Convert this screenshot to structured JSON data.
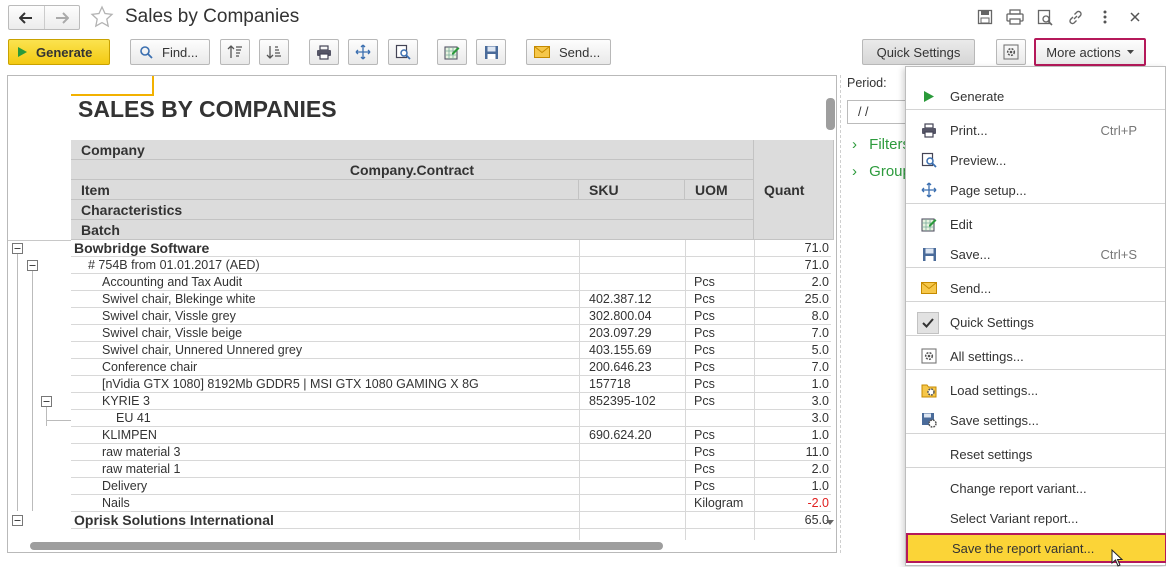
{
  "window": {
    "title": "Sales by Companies"
  },
  "toolbar": {
    "generate_label": "Generate",
    "find_label": "Find...",
    "send_label": "Send...",
    "quick_settings_label": "Quick Settings",
    "more_actions_label": "More actions"
  },
  "report": {
    "title": "SALES BY COMPANIES",
    "headers": {
      "company": "Company",
      "contract": "Company.Contract",
      "item": "Item",
      "sku": "SKU",
      "uom": "UOM",
      "characteristics": "Characteristics",
      "batch": "Batch",
      "quantity": "Quant"
    },
    "rows": [
      {
        "name": "Bowbridge Software",
        "sku": "",
        "uom": "",
        "qty": "71.0",
        "level": 0
      },
      {
        "name": "# 754B from 01.01.2017 (AED)",
        "sku": "",
        "uom": "",
        "qty": "71.0",
        "level": 1
      },
      {
        "name": "Accounting and Tax Audit",
        "sku": "",
        "uom": "Pcs",
        "qty": "2.0",
        "level": 2
      },
      {
        "name": "Swivel chair, Blekinge white",
        "sku": "402.387.12",
        "uom": "Pcs",
        "qty": "25.0",
        "level": 2
      },
      {
        "name": "Swivel chair, Vissle grey",
        "sku": "302.800.04",
        "uom": "Pcs",
        "qty": "8.0",
        "level": 2
      },
      {
        "name": "Swivel chair, Vissle beige",
        "sku": "203.097.29",
        "uom": "Pcs",
        "qty": "7.0",
        "level": 2
      },
      {
        "name": "Swivel chair, Unnered Unnered grey",
        "sku": "403.155.69",
        "uom": "Pcs",
        "qty": "5.0",
        "level": 2
      },
      {
        "name": "Conference chair",
        "sku": "200.646.23",
        "uom": "Pcs",
        "qty": "7.0",
        "level": 2
      },
      {
        "name": "[nVidia GTX 1080] 8192Mb GDDR5 | MSI GTX 1080 GAMING X 8G",
        "sku": "157718",
        "uom": "Pcs",
        "qty": "1.0",
        "level": 2
      },
      {
        "name": "KYRIE 3",
        "sku": "852395-102",
        "uom": "Pcs",
        "qty": "3.0",
        "level": 2
      },
      {
        "name": "EU 41",
        "sku": "",
        "uom": "",
        "qty": "3.0",
        "level": 3
      },
      {
        "name": "KLIMPEN",
        "sku": "690.624.20",
        "uom": "Pcs",
        "qty": "1.0",
        "level": 2
      },
      {
        "name": "raw material 3",
        "sku": "",
        "uom": "Pcs",
        "qty": "11.0",
        "level": 2
      },
      {
        "name": "raw material 1",
        "sku": "",
        "uom": "Pcs",
        "qty": "2.0",
        "level": 2
      },
      {
        "name": "Delivery",
        "sku": "",
        "uom": "Pcs",
        "qty": "1.0",
        "level": 2
      },
      {
        "name": "Nails",
        "sku": "",
        "uom": "Kilogram",
        "qty": "-2.0",
        "level": 2,
        "negative": true
      },
      {
        "name": "Oprisk Solutions International",
        "sku": "",
        "uom": "",
        "qty": "65.0",
        "level": 0
      }
    ]
  },
  "panel": {
    "period_label": "Period:",
    "period_value": "/ /",
    "filters_label": "Filters",
    "grouping_label": "Group"
  },
  "menu": {
    "items": [
      {
        "label": "Generate",
        "shortcut": "",
        "icon": "play-icon"
      },
      {
        "label": "Print...",
        "shortcut": "Ctrl+P",
        "icon": "print-icon"
      },
      {
        "label": "Preview...",
        "shortcut": "",
        "icon": "preview-icon"
      },
      {
        "label": "Page setup...",
        "shortcut": "",
        "icon": "page-setup-icon"
      },
      {
        "label": "Edit",
        "shortcut": "",
        "icon": "edit-icon"
      },
      {
        "label": "Save...",
        "shortcut": "Ctrl+S",
        "icon": "save-icon"
      },
      {
        "label": "Send...",
        "shortcut": "",
        "icon": "envelope-icon"
      },
      {
        "label": "Quick Settings",
        "shortcut": "",
        "icon": "checkbox-icon"
      },
      {
        "label": "All settings...",
        "shortcut": "",
        "icon": "settings-icon"
      },
      {
        "label": "Load settings...",
        "shortcut": "",
        "icon": "load-settings-icon"
      },
      {
        "label": "Save settings...",
        "shortcut": "",
        "icon": "save-settings-icon"
      },
      {
        "label": "Reset settings",
        "shortcut": "",
        "icon": ""
      },
      {
        "label": "Change report variant...",
        "shortcut": "",
        "icon": ""
      },
      {
        "label": "Select Variant report...",
        "shortcut": "",
        "icon": ""
      },
      {
        "label": "Save the report variant...",
        "shortcut": "",
        "icon": ""
      }
    ]
  },
  "colors": {
    "accent_yellow": "#f3c912",
    "highlight_border": "#b5195a",
    "link_green": "#2d9b3d",
    "negative_red": "#e02020"
  }
}
